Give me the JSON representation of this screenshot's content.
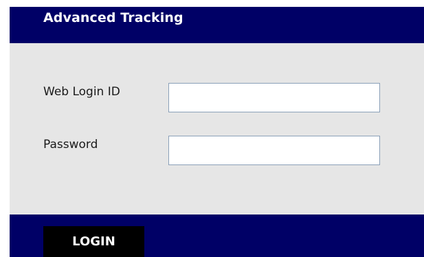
{
  "header": {
    "title": "Advanced Tracking"
  },
  "form": {
    "login_label": "Web Login ID",
    "login_value": "",
    "password_label": "Password",
    "password_value": ""
  },
  "footer": {
    "login_button_label": "LOGIN"
  },
  "colors": {
    "bar": "#000066",
    "panel": "#e6e6e6",
    "button": "#000000",
    "field_border": "#8aa0b8"
  }
}
